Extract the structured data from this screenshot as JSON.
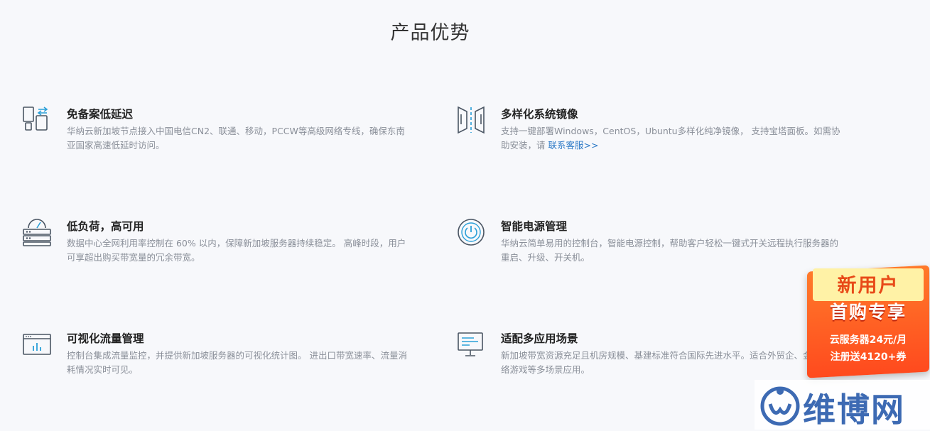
{
  "section": {
    "title": "产品优势"
  },
  "features": [
    {
      "title": "免备案低延迟",
      "desc": "华纳云新加坡节点接入中国电信CN2、联通、移动，PCCW等高级网络专线，确保东南亚国家高速低延时访问。"
    },
    {
      "title": "多样化系统镜像",
      "desc": "支持一键部署Windows，CentOS，Ubuntu多样化纯净镜像， 支持宝塔面板。如需协助安装，请 ",
      "link": "联系客服>>"
    },
    {
      "title": "低负荷，高可用",
      "desc": "数据中心全网利用率控制在 60% 以内，保障新加坡服务器持续稳定。 高峰时段，用户可享超出购买带宽量的冗余带宽。"
    },
    {
      "title": "智能电源管理",
      "desc": "华纳云简单易用的控制台，智能电源控制，帮助客户轻松一键式开关远程执行服务器的重启、升级、开关机。"
    },
    {
      "title": "可视化流量管理",
      "desc": "控制台集成流量监控，并提供新加坡服务器的可视化统计图。 进出口带宽速率、流量消耗情况实时可见。"
    },
    {
      "title": "适配多应用场景",
      "desc": "新加坡带宽资源充足且机房规模、基建标准符合国际先进水平。适合外贸企、金融、网络游戏等多场景应用。"
    }
  ],
  "promo": {
    "line1": "新用户",
    "line2": "首购专享",
    "line3": "云服务器24元/月",
    "line4": "注册送4120+券"
  },
  "watermark": {
    "text": "维博网"
  },
  "icons": [
    "devices-icon",
    "mirror-icon",
    "server-gauge-icon",
    "power-icon",
    "chart-monitor-icon",
    "display-icon"
  ],
  "colors": {
    "accent": "#2a78c6",
    "icon": "#4a5563",
    "icon_accent": "#2a9fd8"
  }
}
